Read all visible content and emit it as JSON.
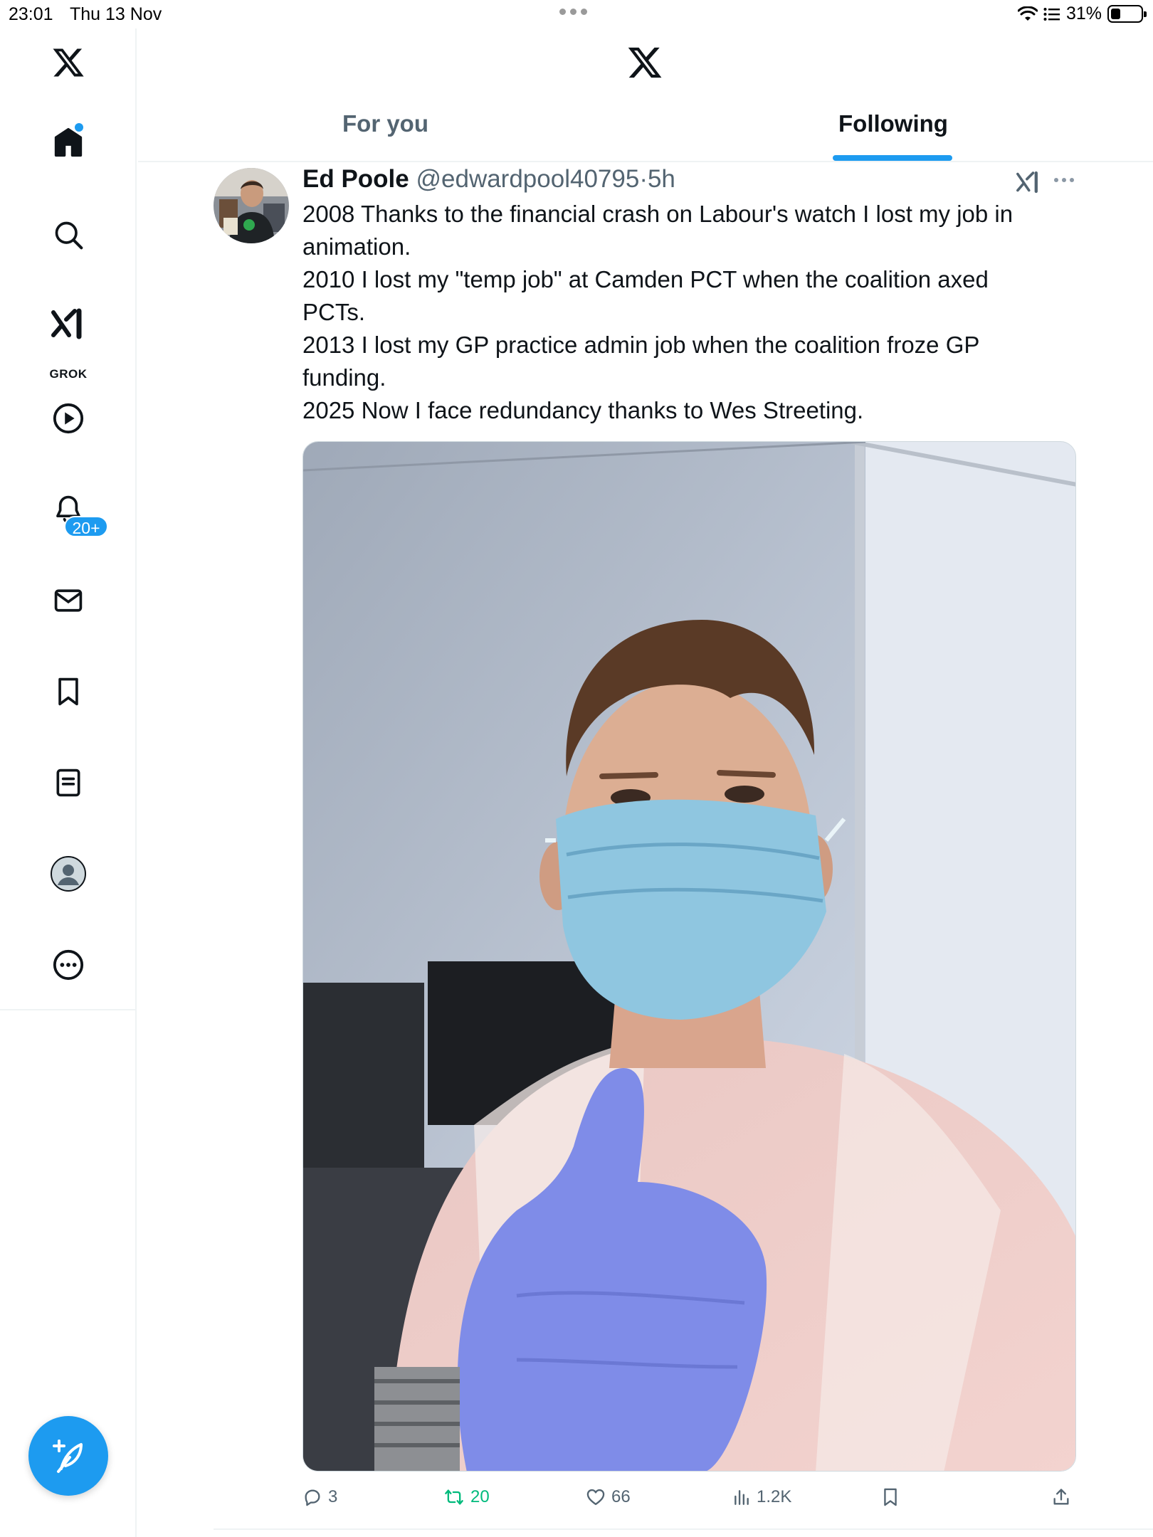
{
  "status_bar": {
    "time": "23:01",
    "date": "Thu 13 Nov",
    "battery": "31%"
  },
  "sidebar": {
    "items": [
      {
        "name": "x-logo"
      },
      {
        "name": "home",
        "active": true
      },
      {
        "name": "search"
      },
      {
        "name": "grok",
        "label": "GROK"
      },
      {
        "name": "videos"
      },
      {
        "name": "notifications",
        "badge": "20+"
      },
      {
        "name": "messages"
      },
      {
        "name": "bookmarks"
      },
      {
        "name": "lists"
      },
      {
        "name": "profile"
      },
      {
        "name": "more"
      }
    ],
    "compose_icon": "compose-plus-feather-icon"
  },
  "header": {
    "tabs": [
      {
        "label": "For you",
        "selected": false
      },
      {
        "label": "Following",
        "selected": true
      }
    ]
  },
  "tweet": {
    "author_name": "Ed Poole",
    "handle": "@edwardpool40795",
    "separator": "·",
    "time_ago": "5h",
    "text_lines": [
      "2008 Thanks to the financial crash on Labour's watch I lost my job in",
      "animation.",
      "2010 I lost my \"temp job\" at Camden PCT when the coalition axed",
      "PCTs.",
      "2013 I lost my GP practice admin job when the coalition froze GP",
      "funding.",
      "2025 Now I face redundancy thanks to Wes Streeting."
    ],
    "media_description_icon": "photo",
    "stats": {
      "replies": "3",
      "reposts": "20",
      "likes": "66",
      "views": "1.2K"
    }
  },
  "colors": {
    "accent": "#1d9bf0",
    "repost_green": "#00ba7c",
    "secondary_text": "#536471",
    "primary_text": "#0f1419"
  }
}
